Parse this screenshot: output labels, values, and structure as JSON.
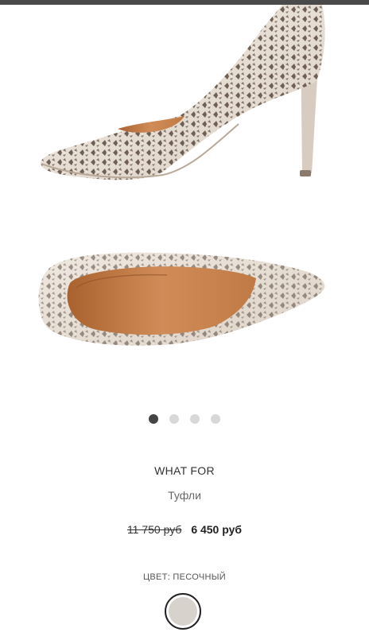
{
  "product": {
    "brand": "WHAT FOR",
    "category": "Туфли",
    "old_price": "11 750 руб",
    "new_price": "6 450 руб",
    "color_label": "ЦВЕТ: ПЕСОЧНЫЙ"
  },
  "gallery": {
    "images": [
      "shoe-side-view",
      "shoe-top-view"
    ],
    "dots_count": 4,
    "active_index": 0
  },
  "colors": {
    "top_bar": "#4a4a4a",
    "shoe_suede": "#e6ddd4",
    "shoe_lining": "#c8824e",
    "swatch": "#d7d2cb"
  }
}
